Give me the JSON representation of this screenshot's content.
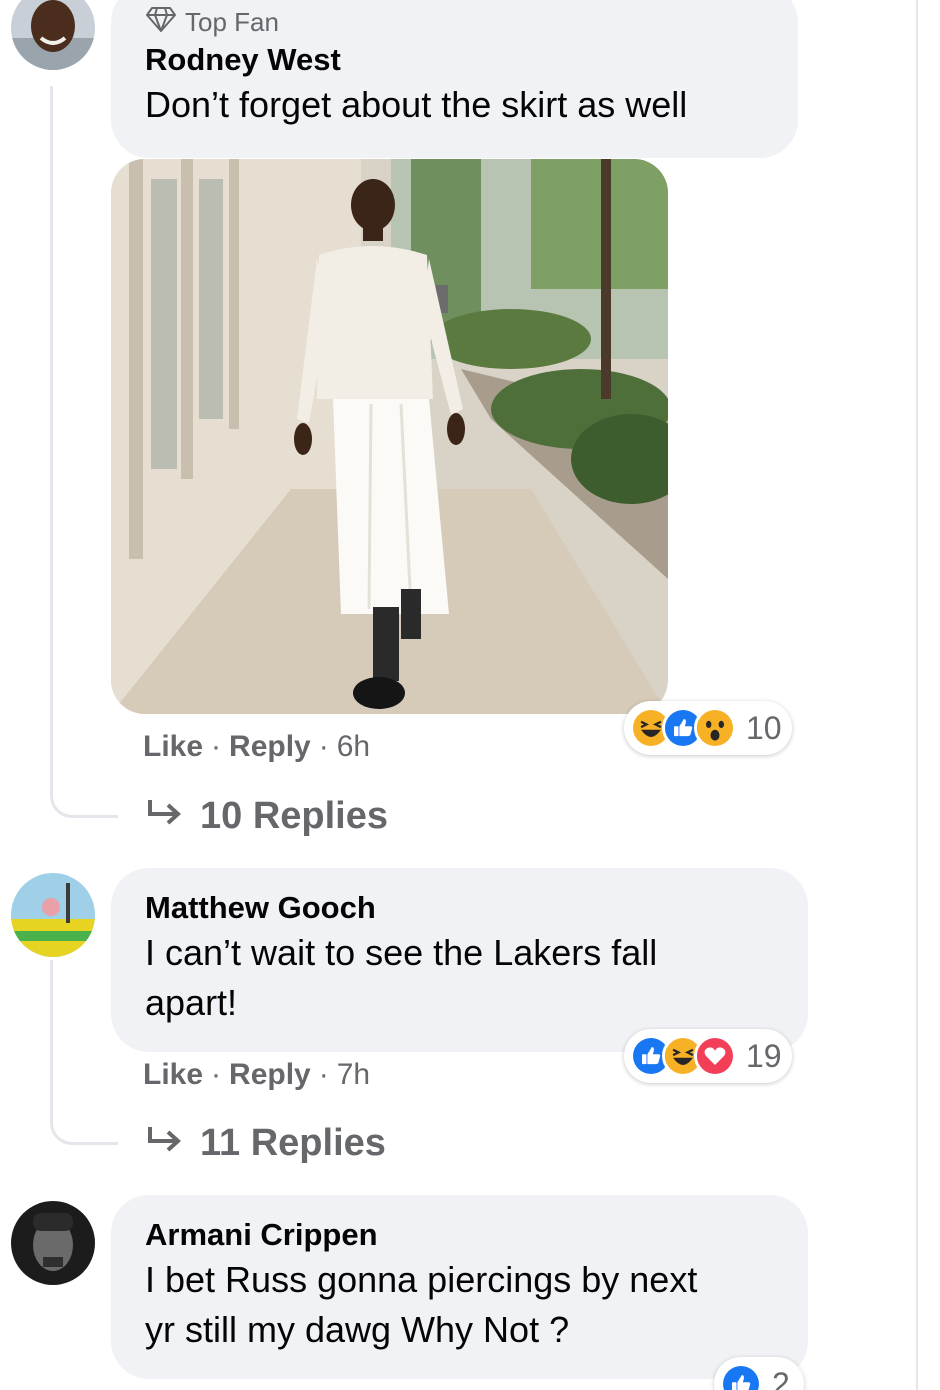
{
  "comments": [
    {
      "badge": "Top Fan",
      "author": "Rodney West",
      "text_lines": [
        "Don’t forget about the skirt as well"
      ],
      "actions": {
        "like": "Like",
        "reply": "Reply",
        "time": "6h"
      },
      "reaction_count": "10",
      "reactions": [
        "haha-icon",
        "like-icon",
        "wow-icon"
      ],
      "replies": "10 Replies"
    },
    {
      "author": "Matthew Gooch",
      "text_lines": [
        "I can’t wait to see the Lakers fall",
        "apart!"
      ],
      "actions": {
        "like": "Like",
        "reply": "Reply",
        "time": "7h"
      },
      "reaction_count": "19",
      "reactions": [
        "like-icon",
        "haha-icon",
        "love-icon"
      ],
      "replies": "11 Replies"
    },
    {
      "author": "Armani Crippen",
      "text_lines": [
        "I bet Russ gonna piercings by next",
        "yr still my dawg Why Not ?"
      ],
      "reaction_count": "2",
      "reactions": [
        "like-icon"
      ]
    }
  ],
  "separator": "·",
  "colors": {
    "bubble": "#f0f2f5",
    "muted": "#65676b",
    "like_blue": "#1877f2",
    "haha_yellow": "#f7b125",
    "love_red": "#f33e58"
  }
}
